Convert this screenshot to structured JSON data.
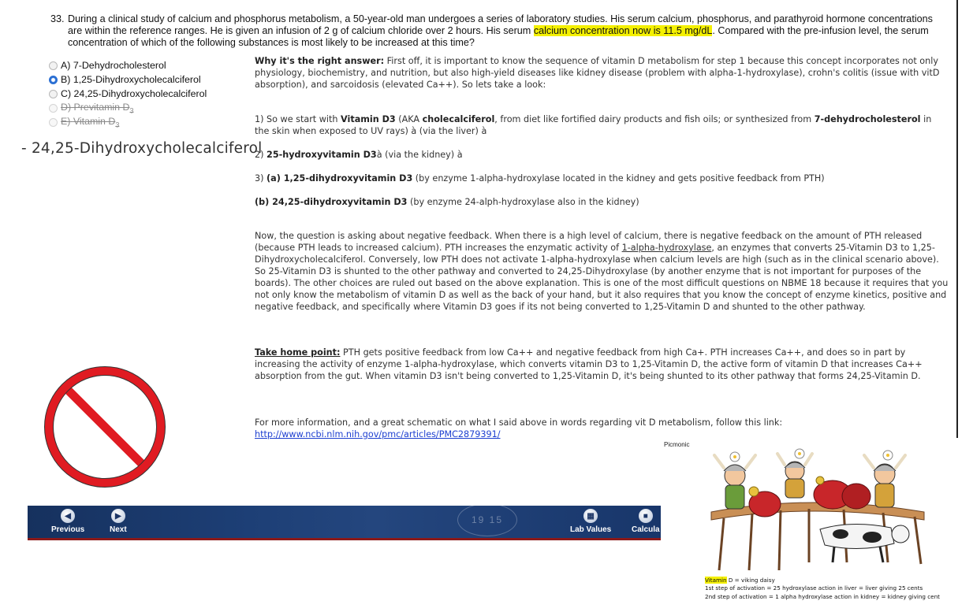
{
  "question": {
    "number": "33.",
    "text_before": "During a clinical study of calcium and phosphorus metabolism, a 50-year-old man undergoes a series of laboratory studies. His serum calcium, phosphorus, and parathyroid hormone concentrations are within the reference ranges. He is given an infusion of 2 g of calcium chloride over 2 hours. His serum ",
    "highlight": "calcium concentration now is 11.5 mg/dL",
    "text_after": ". Compared with the pre-infusion level, the serum concentration of which of the following substances is most likely to be increased at this time?"
  },
  "options": [
    {
      "letter": "A)",
      "text": "7-Dehydrocholesterol"
    },
    {
      "letter": "B)",
      "text": "1,25-Dihydroxycholecalciferol"
    },
    {
      "letter": "C)",
      "text": "24,25-Dihydroxycholecalciferol"
    },
    {
      "letter": "D)",
      "text": "Previtamin D",
      "sub": "3"
    },
    {
      "letter": "E)",
      "text": "Vitamin D",
      "sub": "3"
    }
  ],
  "selected_option": "B",
  "side_note": "- 24,25-Dihydroxycholecalciferol",
  "explanation": {
    "p1_label": "Why it's the right answer:",
    "p1_text": " First off, it is important to know the sequence of vitamin D metabolism for step 1 because this concept incorporates not only physiology, biochemistry, and nutrition, but also high-yield diseases like kidney disease (problem with alpha-1-hydroxylase), crohn's colitis (issue with vitD absorption), and sarcoidosis (elevated Ca++). So lets take a look:",
    "p2_a": "1) So we start with ",
    "p2_b": "Vitamin D3",
    "p2_c": " (AKA ",
    "p2_d": "cholecalciferol",
    "p2_e": ", from diet like fortified dairy products and fish oils; or synthesized from ",
    "p2_f": "7-dehydrocholesterol",
    "p2_g": " in the skin when exposed to UV rays) à (via the liver) à",
    "p3_a": "2) ",
    "p3_b": "25-hydroxyvitamin D3",
    "p3_c": "à (via the kidney) à",
    "p4_a": "3) ",
    "p4_b": "(a) 1,25-dihydroxyvitamin D3",
    "p4_c": " (by enzyme 1-alpha-hydroxylase located in the kidney and gets positive feedback from PTH)",
    "p5_b": "(b) 24,25-dihydroxyvitamin D3",
    "p5_c": " (by enzyme 24-alph-hydroxylase also in the kidney)",
    "p6_a": "Now, the question is asking about negative feedback. When there is a high level of calcium, there is negative feedback on the amount of PTH released (because PTH leads to increased calcium). PTH increases the enzymatic activity of ",
    "p6_u": "1-alpha-hydroxylase",
    "p6_b": ", an enzymes that converts 25-Vitamin D3 to 1,25-Dihydroxycholecalciferol. Conversely, low PTH does not activate 1-alpha-hydroxylase when calcium levels are high (such as in the clinical scenario above). So 25-Vitamin D3 is shunted to the other pathway and converted to 24,25-Dihydroxylase (by another enzyme that is not important for purposes of the boards). The other choices are ruled out based on the above explanation. This is one of the most difficult questions on NBME 18 because it requires that you not only know the metabolism of vitamin D as well as the back of your hand, but it also requires that you know the concept of enzyme kinetics, positive and negative feedback, and specifically where Vitamin D3 goes if its not being converted to 1,25-Vitamin D and shunted to the other pathway.",
    "p7_label": "Take home point:",
    "p7_text": " PTH gets positive feedback from low Ca++ and negative feedback from high Ca+. PTH increases Ca++, and does so in part by increasing the activity of enzyme 1-alpha-hydroxylase, which converts vitamin D3 to 1,25-Vitamin D, the active form of vitamin D that increases Ca++ absorption from the gut. When vitamin D3 isn't being converted to 1,25-Vitamin D, it's being shunted to its other pathway that forms 24,25-Vitamin D.",
    "p8_text": "For more information, and a great schematic on what I said above in words regarding vit D metabolism, follow this link: ",
    "p8_link": "http://www.ncbi.nlm.nih.gov/pmc/articles/PMC2879391/"
  },
  "navbar": {
    "previous": "Previous",
    "next": "Next",
    "lab_values": "Lab Values",
    "calculator": "Calcula",
    "seal_text": "19 15"
  },
  "picmonic": {
    "label": "Picmonic",
    "caption_hl": "Vitamin",
    "caption_1": " D = viking daisy",
    "caption_2": "1st step of activation = 25 hydroxylase action in liver = liver giving 25 cents",
    "caption_3": "2nd step of activation = 1 alpha hydroxylase action in kidney = kidney giving  cent"
  },
  "colors": {
    "highlight": "#f4f000",
    "navbar": "#1d3f76",
    "navbar_border": "#8b1a1a",
    "no_sign": "#e01b22",
    "link": "#1d3fd0"
  }
}
